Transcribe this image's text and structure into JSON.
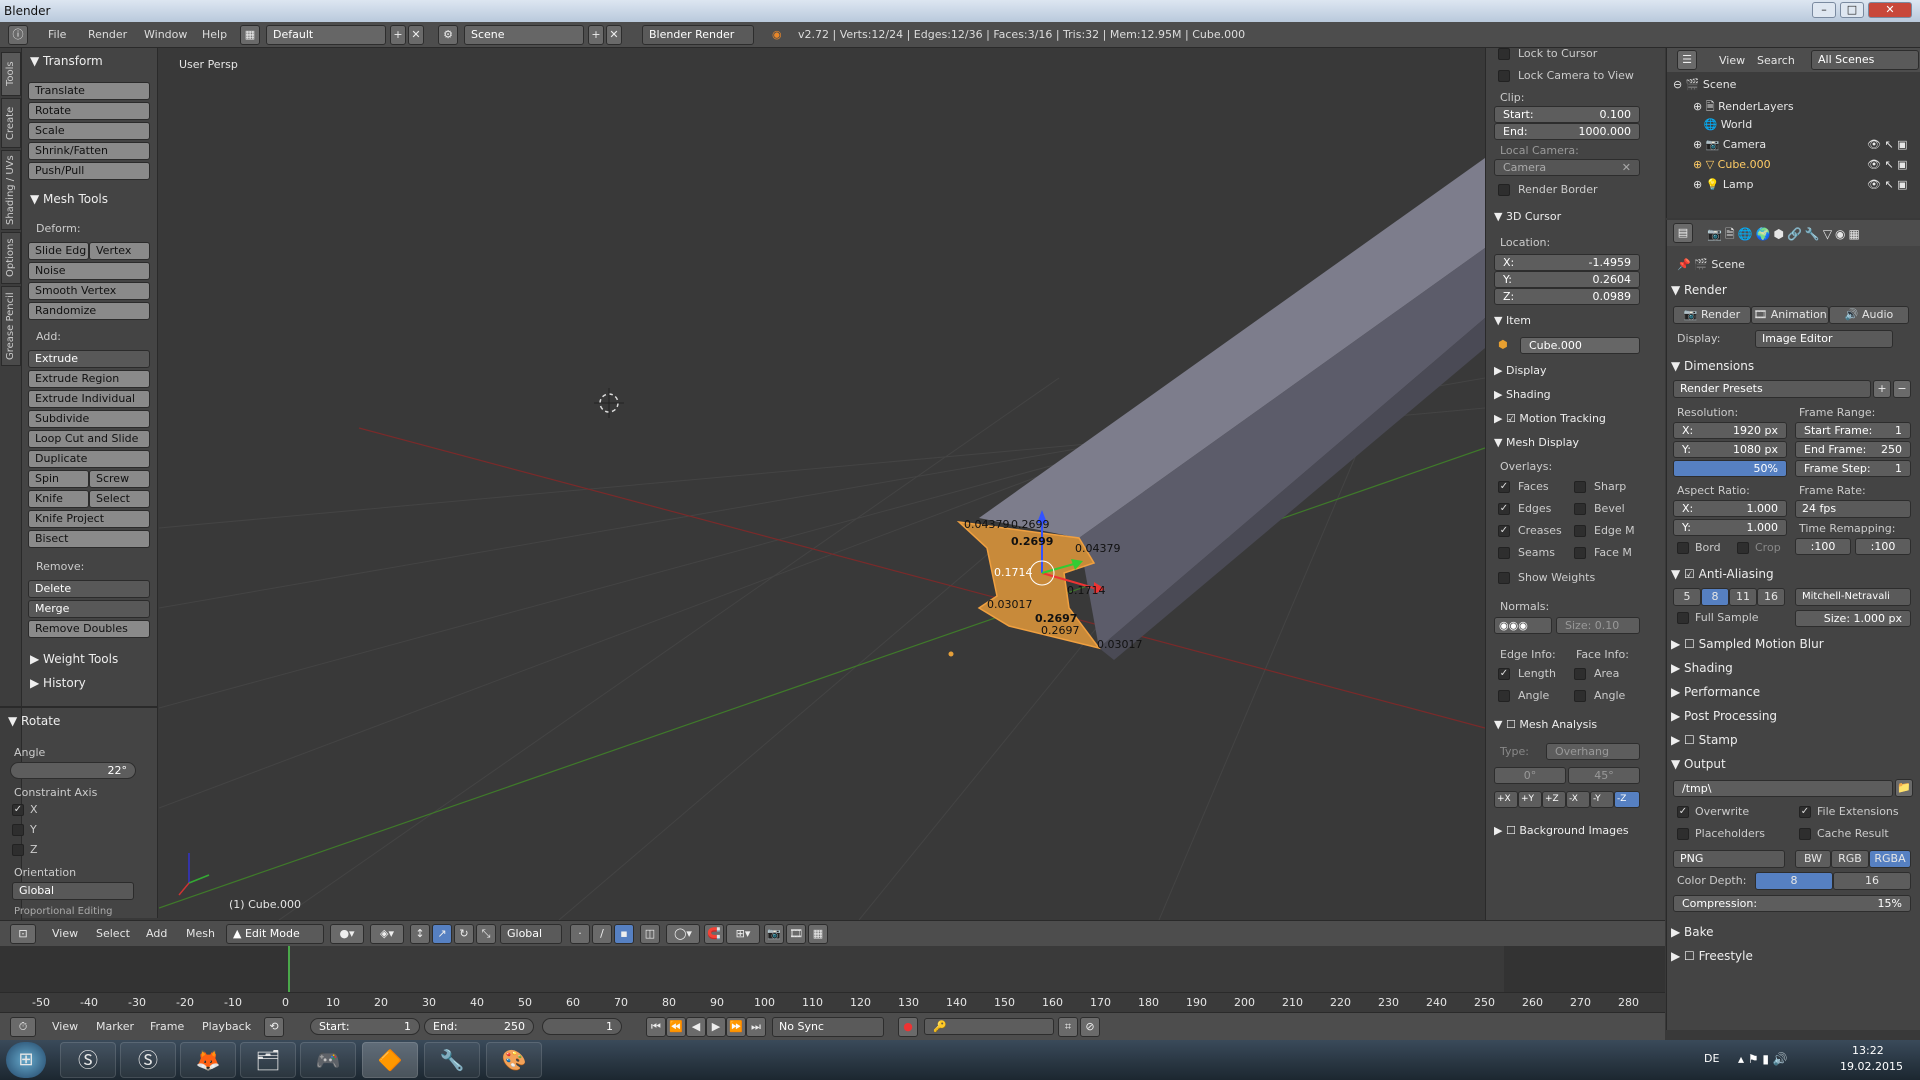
{
  "window": {
    "title": "Blender"
  },
  "infobar": {
    "menus": [
      "File",
      "Render",
      "Window",
      "Help"
    ],
    "layout": "Default",
    "scene": "Scene",
    "engine": "Blender Render",
    "stats": "v2.72 | Verts:12/24 | Edges:12/36 | Faces:3/16 | Tris:32 | Mem:12.95M | Cube.000"
  },
  "tooltabs": [
    "Tools",
    "Create",
    "Shading / UVs",
    "Options",
    "Grease Pencil"
  ],
  "tools": {
    "transform_title": "Transform",
    "transform": [
      "Translate",
      "Rotate",
      "Scale",
      "Shrink/Fatten",
      "Push/Pull"
    ],
    "meshtools_title": "Mesh Tools",
    "deform_label": "Deform:",
    "slide_edge": "Slide Edg",
    "vertex": "Vertex",
    "noise": "Noise",
    "smooth_vertex": "Smooth Vertex",
    "randomize": "Randomize",
    "add_label": "Add:",
    "extrude": "Extrude",
    "extrude_region": "Extrude Region",
    "extrude_individual": "Extrude Individual",
    "subdivide": "Subdivide",
    "loop_cut": "Loop Cut and Slide",
    "duplicate": "Duplicate",
    "spin": "Spin",
    "screw": "Screw",
    "knife": "Knife",
    "select": "Select",
    "knife_project": "Knife Project",
    "bisect": "Bisect",
    "remove_label": "Remove:",
    "delete": "Delete",
    "merge": "Merge",
    "remove_doubles": "Remove Doubles",
    "weight_tools": "Weight Tools",
    "history": "History"
  },
  "operator": {
    "title": "Rotate",
    "angle_label": "Angle",
    "angle": "22°",
    "constraint_label": "Constraint Axis",
    "x": "X",
    "y": "Y",
    "z": "Z",
    "orientation_label": "Orientation",
    "orientation": "Global",
    "prop_edit": "Proportional Editing"
  },
  "viewport": {
    "label": "User Persp",
    "object": "(1) Cube.000",
    "measures": [
      "0.04379",
      "0.2699",
      "0.2699",
      "0.04379",
      "0.1714",
      "0.1714",
      "0.03017",
      "0.2697",
      "0.2697",
      "0.03017"
    ]
  },
  "npanel": {
    "lock_cursor": "Lock to Cursor",
    "lock_camera": "Lock Camera to View",
    "clip_label": "Clip:",
    "start_label": "Start:",
    "start": "0.100",
    "end_label": "End:",
    "end": "1000.000",
    "local_camera": "Local Camera:",
    "camera": "Camera",
    "render_border": "Render Border",
    "cursor_title": "3D Cursor",
    "location_label": "Location:",
    "x_label": "X:",
    "x": "-1.4959",
    "y_label": "Y:",
    "y": "0.2604",
    "z_label": "Z:",
    "z": "0.0989",
    "item_title": "Item",
    "item_name": "Cube.000",
    "display": "Display",
    "shading": "Shading",
    "motion_tracking": "Motion Tracking",
    "mesh_display": "Mesh Display",
    "overlays_label": "Overlays:",
    "faces": "Faces",
    "sharp": "Sharp",
    "edges": "Edges",
    "bevel": "Bevel",
    "creases": "Creases",
    "edge_m": "Edge M",
    "seams": "Seams",
    "face_m": "Face M",
    "show_weights": "Show Weights",
    "normals_label": "Normals:",
    "normals_size": "Size:  0.10",
    "edge_info": "Edge Info:",
    "face_info": "Face Info:",
    "length": "Length",
    "area": "Area",
    "angle": "Angle",
    "angle2": "Angle",
    "mesh_analysis": "Mesh Analysis",
    "type_label": "Type:",
    "type": "Overhang",
    "deg0": "0°",
    "deg45": "45°",
    "axes": [
      "+X",
      "+Y",
      "+Z",
      "-X",
      "-Y",
      "-Z"
    ],
    "bg_images": "Background Images"
  },
  "outliner": {
    "menus": [
      "View",
      "Search"
    ],
    "filter": "All Scenes",
    "items": [
      "Scene",
      "RenderLayers",
      "World",
      "Camera",
      "Cube.000",
      "Lamp"
    ]
  },
  "props": {
    "scene": "Scene",
    "render_title": "Render",
    "render_btn": "Render",
    "animation_btn": "Animation",
    "audio_btn": "Audio",
    "display_label": "Display:",
    "display": "Image Editor",
    "dimensions": "Dimensions",
    "render_presets": "Render Presets",
    "resolution_label": "Resolution:",
    "res_x": "1920 px",
    "res_y": "1080 px",
    "res_pct": "50%",
    "frame_range": "Frame Range:",
    "start_frame": "Start Frame:",
    "start_frame_v": "1",
    "end_frame": "End Frame:",
    "end_frame_v": "250",
    "frame_step": "Frame Step:",
    "frame_step_v": "1",
    "aspect_label": "Aspect Ratio:",
    "asp_x": "1.000",
    "asp_y": "1.000",
    "frame_rate_label": "Frame Rate:",
    "frame_rate": "24 fps",
    "time_remap": "Time Remapping:",
    "remap_old": "100",
    "remap_new": "100",
    "bord": "Bord",
    "crop": "Crop",
    "aa": "Anti-Aliasing",
    "aa_levels": [
      "5",
      "8",
      "11",
      "16"
    ],
    "aa_filter": "Mitchell-Netravali",
    "full_sample": "Full Sample",
    "aa_size": "Size:  1.000 px",
    "sampled_mb": "Sampled Motion Blur",
    "shading": "Shading",
    "performance": "Performance",
    "post_processing": "Post Processing",
    "stamp": "Stamp",
    "output": "Output",
    "output_path": "/tmp\\",
    "overwrite": "Overwrite",
    "file_ext": "File Extensions",
    "placeholders": "Placeholders",
    "cache_result": "Cache Result",
    "format": "PNG",
    "bw": "BW",
    "rgb": "RGB",
    "rgba": "RGBA",
    "color_depth": "Color Depth:",
    "depth8": "8",
    "depth16": "16",
    "compression": "Compression:",
    "compression_v": "15%",
    "bake": "Bake",
    "freestyle": "Freestyle"
  },
  "view3d_header": {
    "menus": [
      "View",
      "Select",
      "Add",
      "Mesh"
    ],
    "mode": "Edit Mode",
    "orientation": "Global"
  },
  "timeline": {
    "ticks": [
      "-50",
      "-40",
      "-30",
      "-20",
      "-10",
      "0",
      "10",
      "20",
      "30",
      "40",
      "50",
      "60",
      "70",
      "80",
      "90",
      "100",
      "110",
      "120",
      "130",
      "140",
      "150",
      "160",
      "170",
      "180",
      "190",
      "200",
      "210",
      "220",
      "230",
      "240",
      "250",
      "260",
      "270",
      "280"
    ],
    "menus": [
      "View",
      "Marker",
      "Frame",
      "Playback"
    ],
    "start": "Start:",
    "start_v": "1",
    "end": "End:",
    "end_v": "250",
    "current": "1",
    "sync": "No Sync"
  },
  "taskbar": {
    "lang": "DE",
    "time": "13:22",
    "date": "19.02.2015"
  },
  "colors": {
    "selection": "#e69a3a",
    "x_axis": "#c33",
    "y_axis": "#3a3",
    "z_axis": "#33c",
    "accent": "#5680c2"
  }
}
